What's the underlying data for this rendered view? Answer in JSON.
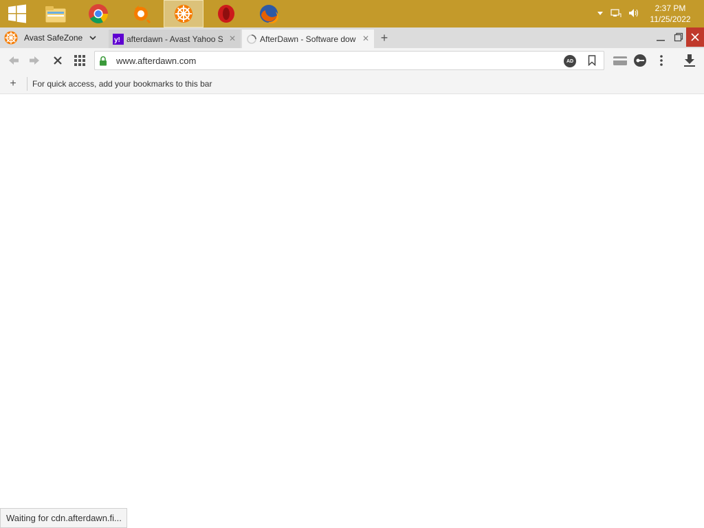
{
  "taskbar": {
    "start_icon": "windows-logo-icon",
    "pinned": [
      {
        "name": "file-explorer",
        "icon": "folder-icon"
      },
      {
        "name": "chrome",
        "icon": "chrome-icon"
      },
      {
        "name": "avast-antivirus",
        "icon": "avast-icon"
      },
      {
        "name": "avast-safezone",
        "icon": "safezone-icon",
        "active": true
      },
      {
        "name": "opera",
        "icon": "opera-icon"
      },
      {
        "name": "firefox",
        "icon": "firefox-icon"
      }
    ],
    "tray": {
      "time": "2:37 PM",
      "date": "11/25/2022"
    },
    "colors": {
      "bar": "#c49a2a",
      "active_button": "#dcc27a"
    }
  },
  "browser": {
    "brand_label": "Avast SafeZone",
    "tabs": [
      {
        "title": "afterdawn - Avast Yahoo S",
        "icon": "yahoo-icon",
        "close": "✕"
      },
      {
        "title": "AfterDawn - Software dow",
        "icon": "loading-spinner-icon",
        "close": "✕",
        "active": true
      }
    ],
    "new_tab_label": "+",
    "address": {
      "url": "www.afterdawn.com",
      "secure": true,
      "adblock_label": "AD"
    },
    "bookmarks_bar": {
      "add_label": "+",
      "message": "For quick access, add your bookmarks to this bar"
    },
    "status_text": "Waiting for cdn.afterdawn.fi...",
    "colors": {
      "close_button": "#c0392b",
      "lock": "#3a9a3a",
      "yahoo": "#5f01d1"
    }
  }
}
